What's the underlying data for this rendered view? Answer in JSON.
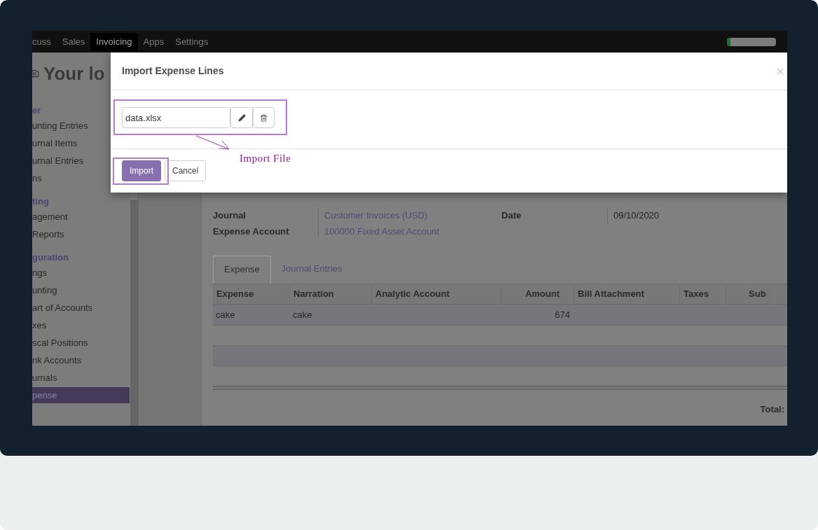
{
  "navbar": {
    "items": [
      {
        "label": "cuss",
        "selected": false
      },
      {
        "label": "Sales",
        "selected": false
      },
      {
        "label": "Invoicing",
        "selected": true
      },
      {
        "label": "Apps",
        "selected": false
      },
      {
        "label": "Settings",
        "selected": false
      }
    ],
    "progress": {
      "level": 0.07
    }
  },
  "sidebar": {
    "logo": "Your lo",
    "items": [
      {
        "kind": "heading",
        "label": "er"
      },
      {
        "kind": "item",
        "label": "unting Entries",
        "selected": false
      },
      {
        "kind": "item",
        "label": "urnal Items",
        "selected": false
      },
      {
        "kind": "item",
        "label": "urnal Entries",
        "selected": false
      },
      {
        "kind": "item",
        "label": "ns",
        "selected": false
      },
      {
        "kind": "heading",
        "label": "ting"
      },
      {
        "kind": "item",
        "label": "agement",
        "selected": false
      },
      {
        "kind": "item",
        "label": "Reports",
        "selected": false
      },
      {
        "kind": "heading",
        "label": "guration"
      },
      {
        "kind": "item",
        "label": "ngs",
        "selected": false
      },
      {
        "kind": "item",
        "label": "unting",
        "selected": false
      },
      {
        "kind": "item",
        "label": "art of Accounts",
        "selected": false
      },
      {
        "kind": "item",
        "label": "xes",
        "selected": false
      },
      {
        "kind": "item",
        "label": "scal Positions",
        "selected": false
      },
      {
        "kind": "item",
        "label": "nk Accounts",
        "selected": false
      },
      {
        "kind": "item",
        "label": "urnals",
        "selected": false
      },
      {
        "kind": "item",
        "label": "pense",
        "selected": true
      }
    ]
  },
  "form": {
    "fields_left": [
      {
        "label": "Journal",
        "value": "Customer Invoices (USD)"
      },
      {
        "label": "Expense Account",
        "value": "100000 Fixed Asset Account"
      }
    ],
    "fields_right": [
      {
        "label": "Date",
        "value": "09/10/2020"
      }
    ],
    "tabs": [
      {
        "label": "Expense",
        "selected": true
      },
      {
        "label": "Journal Entries",
        "selected": false
      }
    ],
    "table": {
      "columns": [
        "Expense",
        "Narration",
        "Analytic Account",
        "Amount",
        "Bill Attachment",
        "Taxes",
        "Sub"
      ],
      "rows": [
        [
          "cake",
          "cake",
          "",
          "674",
          "",
          "",
          ""
        ]
      ]
    },
    "total_label": "Total:"
  },
  "dialog": {
    "title": "Import Expense Lines",
    "close": "×",
    "file_field": {
      "value": "data.xlsx"
    },
    "buttons": [
      {
        "label": "Import",
        "kind": "primary"
      },
      {
        "label": "Cancel",
        "kind": "secondary"
      }
    ],
    "annotation": "Import File"
  }
}
